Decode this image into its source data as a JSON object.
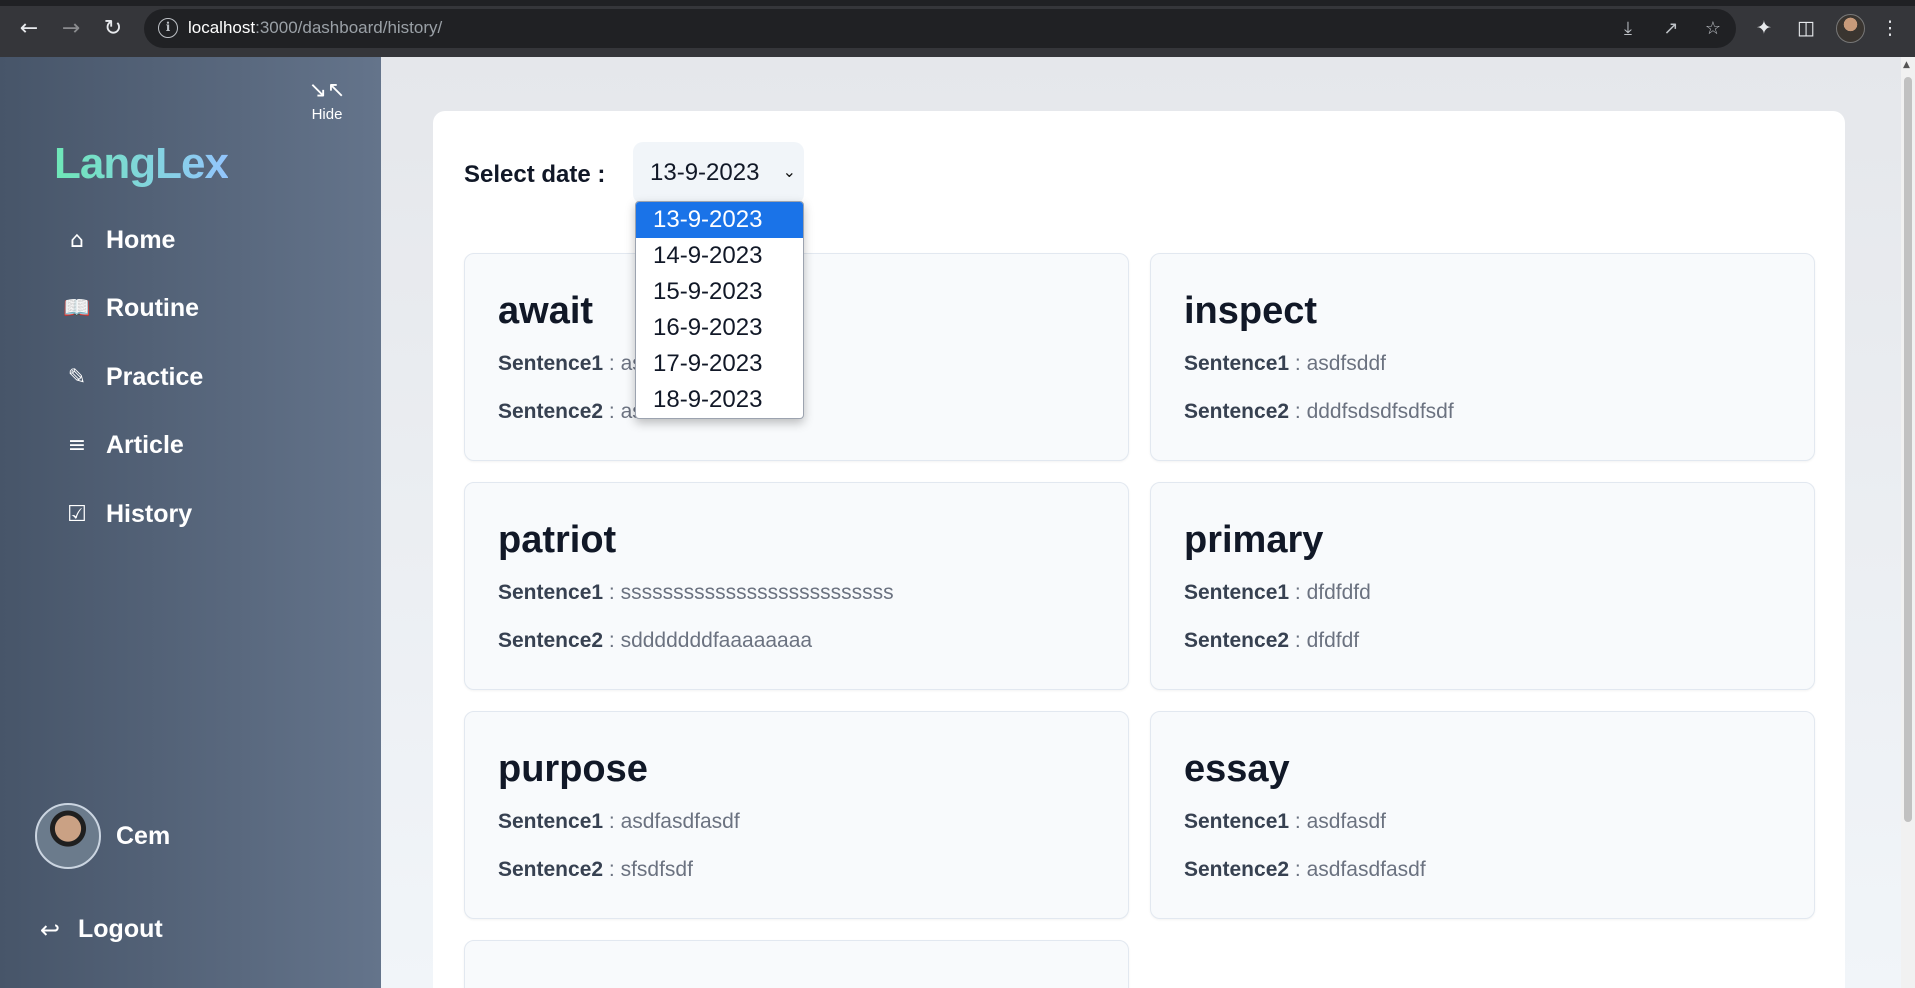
{
  "browser": {
    "url_host": "localhost",
    "url_rest": ":3000/dashboard/history/"
  },
  "sidebar": {
    "hide_label": "Hide",
    "logo": "LangLex",
    "items": [
      {
        "label": "Home",
        "icon": "home-icon"
      },
      {
        "label": "Routine",
        "icon": "book-icon"
      },
      {
        "label": "Practice",
        "icon": "pencil-icon"
      },
      {
        "label": "Article",
        "icon": "markdown-icon"
      },
      {
        "label": "History",
        "icon": "calendar-check-icon"
      }
    ],
    "user_name": "Cem",
    "logout_label": "Logout"
  },
  "main": {
    "date_label": "Select date :",
    "selected_date": "13-9-2023",
    "date_options": [
      "13-9-2023",
      "14-9-2023",
      "15-9-2023",
      "16-9-2023",
      "17-9-2023",
      "18-9-2023"
    ],
    "cards": [
      {
        "word": "await",
        "s1_label": "Sentence1",
        "s1": ": asdfasdfasdf",
        "s2_label": "Sentence2",
        "s2": ": asdfasdfasdfasdfa"
      },
      {
        "word": "inspect",
        "s1_label": "Sentence1",
        "s1": ": asdfsddf",
        "s2_label": "Sentence2",
        "s2": ": dddfsdsdfsdfsdf"
      },
      {
        "word": "patriot",
        "s1_label": "Sentence1",
        "s1": ": ssssssssssssssssssssssssss",
        "s2_label": "Sentence2",
        "s2": ": sdddddddfaaaaaaaa"
      },
      {
        "word": "primary",
        "s1_label": "Sentence1",
        "s1": ": dfdfdfd",
        "s2_label": "Sentence2",
        "s2": ": dfdfdf"
      },
      {
        "word": "purpose",
        "s1_label": "Sentence1",
        "s1": ": asdfasdfasdf",
        "s2_label": "Sentence2",
        "s2": ": sfsdfsdf"
      },
      {
        "word": "essay",
        "s1_label": "Sentence1",
        "s1": ": asdfasdf",
        "s2_label": "Sentence2",
        "s2": ": asdfasdfasdf"
      }
    ]
  },
  "colors": {
    "sidebar_start": "#475569",
    "sidebar_end": "#64748b",
    "logo_start": "#6ee7b7",
    "logo_end": "#93c5fd",
    "dropdown_selected": "#1a73e8"
  }
}
